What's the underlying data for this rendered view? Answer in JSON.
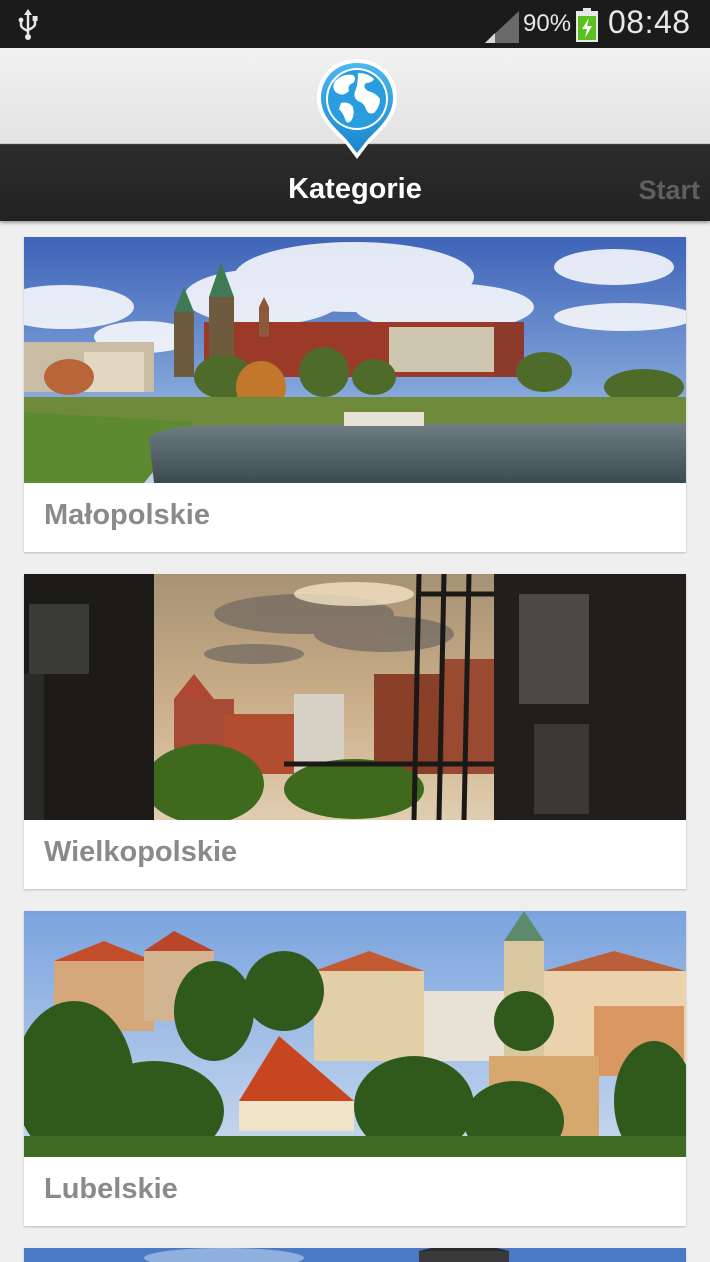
{
  "status_bar": {
    "battery_percent": "90%",
    "time": "08:48"
  },
  "header": {
    "title": "Kategorie",
    "start_label": "Start"
  },
  "categories": [
    {
      "label": "Małopolskie"
    },
    {
      "label": "Wielkopolskie"
    },
    {
      "label": "Lubelskie"
    }
  ],
  "colors": {
    "status_bar_bg": "#1b1b1b",
    "header_bar_bg": "#262626",
    "logo_blue": "#2a9de0",
    "card_label": "#8a8a8a",
    "battery_green": "#5bbf1e"
  },
  "icons": {
    "status_left": "usb-icon",
    "signal": "signal-icon",
    "battery": "battery-charging-icon",
    "logo": "globe-pin-icon"
  }
}
